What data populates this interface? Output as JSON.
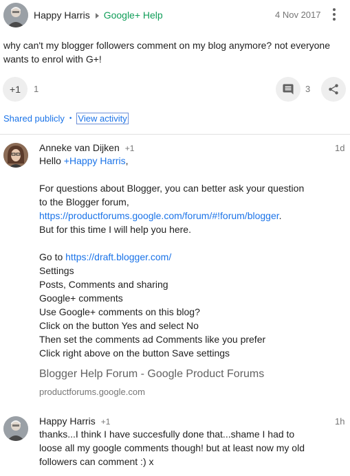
{
  "post": {
    "author": "Happy Harris",
    "community": "Google+ Help",
    "date": "4 Nov 2017",
    "text_line1": "why can't my blogger followers comment on my blog anymore? not everyone",
    "text_line2": "wants to enrol with G+!",
    "plus_one_label": "+1",
    "plus_one_count": "1",
    "comment_count": "3",
    "shared_label": "Shared publicly",
    "separator": "•",
    "view_activity_label": "View activity",
    "icons": [
      "overflow-menu-icon",
      "comment-icon",
      "share-icon",
      "chevron-right-icon"
    ]
  },
  "comments": [
    {
      "author": "Anneke van Dijken",
      "plus": "+1",
      "time": "1d",
      "lines": {
        "l1_prefix": "Hello ",
        "l1_link": "+Happy Harris",
        "l1_suffix": ",",
        "l3": "For questions about Blogger, you can better ask your question",
        "l4": "to the Blogger forum,",
        "l5_link": "https://productforums.google.com/forum/#!forum/blogger",
        "l5_suffix": ".",
        "l6": "But for this time I will help you here.",
        "l8_prefix": "Go to ",
        "l8_link": "https://draft.blogger.com/",
        "l9": "Settings",
        "l10": "Posts, Comments and sharing",
        "l11": "Google+ comments",
        "l12": "Use Google+ comments on this blog?",
        "l13": "Click on the button Yes and select No",
        "l14": "Then set the comments ad Comments like you prefer",
        "l15": "Click right above on the button Save settings"
      },
      "link_preview": {
        "title": "Blogger Help Forum - Google Product Forums",
        "domain": "productforums.google.com"
      }
    },
    {
      "author": "Happy Harris",
      "plus": "+1",
      "time": "1h",
      "line1": "thanks...I think I have succesfully done that...shame I had to",
      "line2": "loose all my google comments though! but at least now my old",
      "line3": "followers can comment :) x"
    }
  ]
}
